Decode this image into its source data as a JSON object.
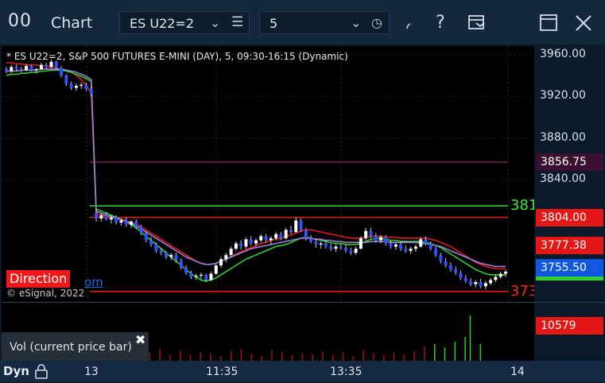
{
  "titlebar": {
    "app_icon": "00",
    "title": "Chart",
    "symbol": "ES U22=2",
    "interval": "5",
    "icons": {
      "symbol_chevron": "chevron-down-icon",
      "symbol_menu": "list-icon",
      "interval_chevron": "chevron-down-icon",
      "interval_clock": "clock-icon",
      "draw": "draw-icon",
      "help": "help-icon",
      "layout": "layout-icon",
      "maximize": "maximize-icon",
      "close": "close-icon"
    },
    "help_label": "?"
  },
  "chart": {
    "description": "* ES U22=2, S&P 500 FUTURES E-MINI (DAY), 5, 09:30-16:15 (Dynamic)",
    "direction_label": "Direction",
    "link_fragment": "om",
    "copyright": "© eSignal, 2022",
    "level_labels": [
      {
        "text": "381",
        "color": "#3ee83e",
        "price": 3815
      },
      {
        "text": "373",
        "color": "#ff2424",
        "price": 3733
      }
    ],
    "y_ticks": [
      "3960.00",
      "3920.00",
      "3880.00",
      "3840.00"
    ],
    "y_tick_values": [
      3960,
      3920,
      3880,
      3840
    ],
    "price_tags": [
      {
        "label": "3856.75",
        "price": 3856.75,
        "bg": "#3a1030",
        "fg": "#ffffff"
      },
      {
        "label": "3804.00",
        "price": 3804.0,
        "bg": "#e41616",
        "fg": "#ffffff"
      },
      {
        "label": "3777.38",
        "price": 3777.38,
        "bg": "#e41616",
        "fg": "#ffffff"
      },
      {
        "label": "3755.50",
        "price": 3755.5,
        "bg": "#1257e0",
        "fg": "#ffffff"
      }
    ],
    "horizontal_levels": [
      {
        "price": 3856.75,
        "color": "#6b1c55"
      },
      {
        "price": 3815,
        "color": "#2fd02f"
      },
      {
        "price": 3804,
        "color": "#e01818"
      },
      {
        "price": 3733,
        "color": "#e01818"
      }
    ]
  },
  "chart_data": {
    "type": "candlestick",
    "y_range": [
      3723,
      3968
    ],
    "y_ticks": [
      3960,
      3920,
      3880,
      3840
    ],
    "x_tick_labels": [
      "13",
      "11:35",
      "13:35",
      "14"
    ],
    "candles": [
      [
        3946,
        3948,
        3942,
        3944
      ],
      [
        3944,
        3950,
        3942,
        3948
      ],
      [
        3948,
        3950,
        3944,
        3946
      ],
      [
        3946,
        3948,
        3943,
        3945
      ],
      [
        3945,
        3951,
        3944,
        3949
      ],
      [
        3949,
        3950,
        3944,
        3945
      ],
      [
        3945,
        3947,
        3942,
        3946
      ],
      [
        3946,
        3952,
        3945,
        3950
      ],
      [
        3950,
        3952,
        3946,
        3948
      ],
      [
        3948,
        3955,
        3947,
        3953
      ],
      [
        3953,
        3954,
        3946,
        3947
      ],
      [
        3947,
        3949,
        3938,
        3940
      ],
      [
        3940,
        3941,
        3930,
        3932
      ],
      [
        3932,
        3934,
        3926,
        3928
      ],
      [
        3928,
        3932,
        3925,
        3930
      ],
      [
        3930,
        3933,
        3927,
        3931
      ],
      [
        3931,
        3933,
        3925,
        3927
      ],
      [
        3927,
        3930,
        3920,
        3922
      ],
      [
        3808,
        3812,
        3800,
        3803
      ],
      [
        3803,
        3808,
        3800,
        3806
      ],
      [
        3806,
        3809,
        3801,
        3802
      ],
      [
        3802,
        3806,
        3798,
        3804
      ],
      [
        3804,
        3806,
        3797,
        3799
      ],
      [
        3799,
        3803,
        3796,
        3801
      ],
      [
        3801,
        3804,
        3795,
        3797
      ],
      [
        3797,
        3801,
        3794,
        3800
      ],
      [
        3800,
        3802,
        3793,
        3795
      ],
      [
        3795,
        3797,
        3787,
        3789
      ],
      [
        3789,
        3791,
        3780,
        3782
      ],
      [
        3782,
        3785,
        3776,
        3778
      ],
      [
        3778,
        3780,
        3770,
        3772
      ],
      [
        3772,
        3775,
        3768,
        3770
      ],
      [
        3770,
        3772,
        3764,
        3766
      ],
      [
        3766,
        3770,
        3763,
        3768
      ],
      [
        3768,
        3770,
        3761,
        3763
      ],
      [
        3763,
        3765,
        3754,
        3756
      ],
      [
        3756,
        3758,
        3749,
        3751
      ],
      [
        3751,
        3753,
        3745,
        3747
      ],
      [
        3747,
        3750,
        3744,
        3748
      ],
      [
        3748,
        3751,
        3745,
        3749
      ],
      [
        3749,
        3750,
        3742,
        3744
      ],
      [
        3744,
        3752,
        3743,
        3750
      ],
      [
        3750,
        3760,
        3749,
        3758
      ],
      [
        3758,
        3766,
        3756,
        3764
      ],
      [
        3764,
        3770,
        3761,
        3768
      ],
      [
        3768,
        3776,
        3766,
        3774
      ],
      [
        3774,
        3781,
        3772,
        3779
      ],
      [
        3779,
        3782,
        3773,
        3776
      ],
      [
        3776,
        3785,
        3774,
        3783
      ],
      [
        3783,
        3786,
        3777,
        3779
      ],
      [
        3779,
        3784,
        3776,
        3782
      ],
      [
        3782,
        3788,
        3780,
        3786
      ],
      [
        3786,
        3788,
        3780,
        3782
      ],
      [
        3782,
        3786,
        3778,
        3784
      ],
      [
        3784,
        3790,
        3782,
        3788
      ],
      [
        3788,
        3790,
        3782,
        3784
      ],
      [
        3784,
        3794,
        3783,
        3792
      ],
      [
        3792,
        3796,
        3788,
        3790
      ],
      [
        3790,
        3804,
        3789,
        3801
      ],
      [
        3801,
        3803,
        3790,
        3792
      ],
      [
        3792,
        3794,
        3782,
        3784
      ],
      [
        3784,
        3787,
        3779,
        3781
      ],
      [
        3781,
        3784,
        3775,
        3778
      ],
      [
        3778,
        3781,
        3774,
        3779
      ],
      [
        3779,
        3782,
        3774,
        3776
      ],
      [
        3776,
        3779,
        3772,
        3774
      ],
      [
        3774,
        3778,
        3771,
        3776
      ],
      [
        3776,
        3779,
        3773,
        3775
      ],
      [
        3775,
        3778,
        3770,
        3772
      ],
      [
        3772,
        3775,
        3768,
        3770
      ],
      [
        3770,
        3776,
        3768,
        3774
      ],
      [
        3774,
        3786,
        3773,
        3784
      ],
      [
        3784,
        3794,
        3782,
        3791
      ],
      [
        3791,
        3794,
        3784,
        3786
      ],
      [
        3786,
        3789,
        3780,
        3782
      ],
      [
        3782,
        3787,
        3779,
        3785
      ],
      [
        3785,
        3787,
        3777,
        3779
      ],
      [
        3779,
        3782,
        3774,
        3776
      ],
      [
        3776,
        3780,
        3773,
        3778
      ],
      [
        3778,
        3781,
        3772,
        3774
      ],
      [
        3774,
        3777,
        3770,
        3772
      ],
      [
        3772,
        3776,
        3769,
        3774
      ],
      [
        3774,
        3778,
        3771,
        3776
      ],
      [
        3776,
        3785,
        3775,
        3783
      ],
      [
        3783,
        3786,
        3777,
        3779
      ],
      [
        3779,
        3781,
        3772,
        3774
      ],
      [
        3774,
        3776,
        3766,
        3768
      ],
      [
        3768,
        3770,
        3760,
        3762
      ],
      [
        3762,
        3765,
        3756,
        3758
      ],
      [
        3758,
        3761,
        3752,
        3754
      ],
      [
        3754,
        3757,
        3749,
        3751
      ],
      [
        3751,
        3753,
        3744,
        3746
      ],
      [
        3746,
        3749,
        3741,
        3743
      ],
      [
        3743,
        3746,
        3738,
        3740
      ],
      [
        3740,
        3744,
        3737,
        3742
      ],
      [
        3742,
        3745,
        3736,
        3738
      ],
      [
        3738,
        3743,
        3735,
        3741
      ],
      [
        3741,
        3746,
        3739,
        3744
      ],
      [
        3744,
        3749,
        3742,
        3747
      ],
      [
        3747,
        3752,
        3745,
        3750
      ],
      [
        3750,
        3754,
        3747,
        3752
      ]
    ],
    "series": [
      {
        "color": "#e01818",
        "values": [
          3952,
          3952,
          3951,
          3951,
          3950,
          3950,
          3950,
          3949,
          3949,
          3948,
          3947,
          3946,
          3945,
          3943,
          3940,
          3936,
          3930,
          3923,
          3808,
          3806,
          3805,
          3804,
          3803,
          3802,
          3801,
          3799,
          3797,
          3795,
          3792,
          3789,
          3786,
          3783,
          3780,
          3777,
          3774,
          3771,
          3768,
          3765,
          3762,
          3760,
          3759,
          3759,
          3760,
          3762,
          3764,
          3766,
          3769,
          3771,
          3773,
          3775,
          3777,
          3779,
          3780,
          3782,
          3783,
          3784,
          3786,
          3787,
          3789,
          3791,
          3792,
          3792,
          3791,
          3790,
          3789,
          3788,
          3787,
          3786,
          3785,
          3784,
          3784,
          3784,
          3785,
          3786,
          3786,
          3786,
          3785,
          3785,
          3785,
          3784,
          3784,
          3784,
          3784,
          3784,
          3784,
          3783,
          3782,
          3780,
          3778,
          3776,
          3773,
          3770,
          3767,
          3764,
          3761,
          3759,
          3757,
          3756,
          3755,
          3755,
          3755
        ]
      },
      {
        "color": "#2ccf2c",
        "values": [
          3940,
          3941,
          3941,
          3942,
          3942,
          3943,
          3943,
          3944,
          3944,
          3945,
          3945,
          3945,
          3944,
          3943,
          3941,
          3939,
          3937,
          3934,
          3812,
          3810,
          3808,
          3806,
          3804,
          3802,
          3800,
          3797,
          3794,
          3790,
          3786,
          3782,
          3778,
          3774,
          3770,
          3766,
          3762,
          3758,
          3754,
          3750,
          3747,
          3744,
          3743,
          3744,
          3746,
          3749,
          3752,
          3755,
          3758,
          3761,
          3764,
          3766,
          3768,
          3770,
          3772,
          3774,
          3776,
          3777,
          3778,
          3780,
          3782,
          3784,
          3785,
          3784,
          3783,
          3782,
          3781,
          3780,
          3779,
          3779,
          3778,
          3778,
          3778,
          3779,
          3781,
          3783,
          3784,
          3784,
          3783,
          3782,
          3782,
          3781,
          3781,
          3781,
          3781,
          3781,
          3780,
          3779,
          3777,
          3775,
          3772,
          3769,
          3766,
          3763,
          3760,
          3757,
          3754,
          3752,
          3750,
          3749,
          3749,
          3749,
          3749
        ]
      },
      {
        "color": "#9a7fd8",
        "values": [
          3944,
          3944,
          3944,
          3945,
          3945,
          3945,
          3945,
          3946,
          3946,
          3946,
          3946,
          3946,
          3945,
          3944,
          3943,
          3941,
          3939,
          3936,
          3810,
          3808,
          3806,
          3805,
          3803,
          3802,
          3800,
          3798,
          3796,
          3793,
          3790,
          3787,
          3784,
          3781,
          3778,
          3775,
          3772,
          3769,
          3766,
          3764,
          3762,
          3760,
          3759,
          3759,
          3760,
          3762,
          3764,
          3766,
          3768,
          3770,
          3772,
          3774,
          3775,
          3776,
          3777,
          3778,
          3779,
          3780,
          3781,
          3782,
          3783,
          3784,
          3784,
          3784,
          3783,
          3783,
          3782,
          3782,
          3781,
          3781,
          3780,
          3780,
          3780,
          3780,
          3780,
          3781,
          3781,
          3781,
          3781,
          3780,
          3780,
          3780,
          3780,
          3780,
          3780,
          3779,
          3779,
          3778,
          3777,
          3776,
          3774,
          3772,
          3770,
          3768,
          3766,
          3764,
          3762,
          3760,
          3759,
          3758,
          3757,
          3757,
          3757
        ]
      }
    ],
    "volumes": [
      {
        "x": 0.01,
        "h": 0.15
      },
      {
        "x": 0.03,
        "h": 0.25
      },
      {
        "x": 0.05,
        "h": 0.2
      },
      {
        "x": 0.07,
        "h": 0.3
      },
      {
        "x": 0.09,
        "h": 0.18
      },
      {
        "x": 0.11,
        "h": 0.22
      },
      {
        "x": 0.13,
        "h": 0.35
      },
      {
        "x": 0.15,
        "h": 0.12
      },
      {
        "x": 0.17,
        "h": 0.35
      },
      {
        "x": 0.19,
        "h": 0.2
      },
      {
        "x": 0.21,
        "h": 0.28
      },
      {
        "x": 0.23,
        "h": 0.15
      },
      {
        "x": 0.25,
        "h": 0.2
      },
      {
        "x": 0.27,
        "h": 0.1
      },
      {
        "x": 0.29,
        "h": 0.18
      },
      {
        "x": 0.31,
        "h": 0.25
      },
      {
        "x": 0.33,
        "h": 0.14
      },
      {
        "x": 0.35,
        "h": 0.22
      },
      {
        "x": 0.37,
        "h": 0.12
      },
      {
        "x": 0.39,
        "h": 0.18
      },
      {
        "x": 0.41,
        "h": 0.16
      },
      {
        "x": 0.43,
        "h": 0.1
      },
      {
        "x": 0.45,
        "h": 0.2
      },
      {
        "x": 0.47,
        "h": 0.25
      },
      {
        "x": 0.49,
        "h": 0.15
      },
      {
        "x": 0.51,
        "h": 0.1
      },
      {
        "x": 0.53,
        "h": 0.22
      },
      {
        "x": 0.55,
        "h": 0.18
      },
      {
        "x": 0.57,
        "h": 0.12
      },
      {
        "x": 0.59,
        "h": 0.16
      },
      {
        "x": 0.61,
        "h": 0.14
      },
      {
        "x": 0.63,
        "h": 0.2
      },
      {
        "x": 0.65,
        "h": 0.12
      },
      {
        "x": 0.67,
        "h": 0.18
      },
      {
        "x": 0.69,
        "h": 0.1
      },
      {
        "x": 0.71,
        "h": 0.22
      },
      {
        "x": 0.73,
        "h": 0.16
      },
      {
        "x": 0.75,
        "h": 0.12
      },
      {
        "x": 0.77,
        "h": 0.18
      },
      {
        "x": 0.79,
        "h": 0.14
      },
      {
        "x": 0.81,
        "h": 0.2
      },
      {
        "x": 0.83,
        "h": 0.3
      },
      {
        "x": 0.85,
        "h": 0.35
      },
      {
        "x": 0.87,
        "h": 0.28
      },
      {
        "x": 0.89,
        "h": 0.4
      },
      {
        "x": 0.91,
        "h": 0.5
      },
      {
        "x": 0.92,
        "h": 0.95
      },
      {
        "x": 0.94,
        "h": 0.35
      }
    ]
  },
  "volume": {
    "label": "Vol (current price bar)",
    "close_icon": "close-icon",
    "value_tag": "10579"
  },
  "timeaxis": {
    "mode": "Dyn",
    "lock_icon": "lock-icon",
    "labels": [
      "13",
      "11:35",
      "13:35",
      "14"
    ]
  }
}
